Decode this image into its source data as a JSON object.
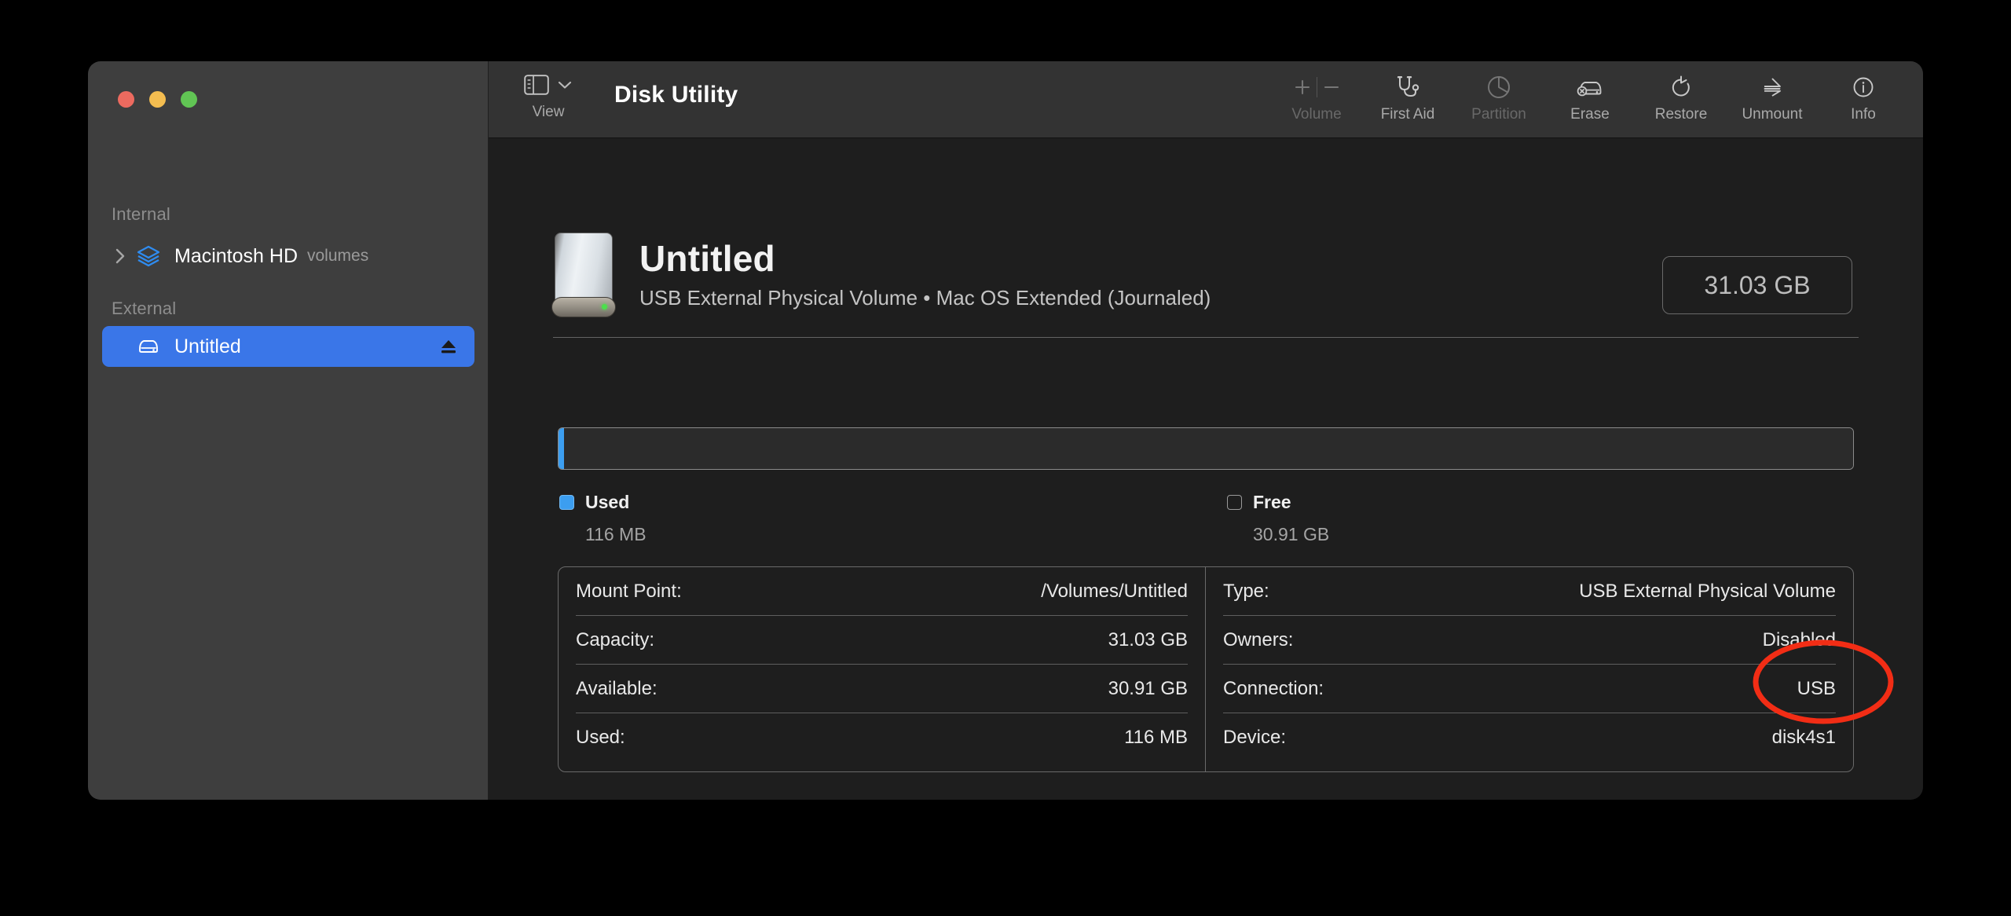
{
  "window": {
    "traffic_lights": [
      "close",
      "minimize",
      "zoom"
    ],
    "colors": {
      "close": "#ec6a5f",
      "minimize": "#f4bd50",
      "zoom": "#61c554",
      "accent": "#3a76e8",
      "used_bar": "#3c9ef0",
      "annotation": "#f22d15"
    }
  },
  "sidebar": {
    "sections": [
      {
        "header": "Internal",
        "items": [
          {
            "label": "Macintosh HD",
            "sub": "volumes",
            "icon": "stacked-layers-icon",
            "disclosure": "chevron-right-icon",
            "selected": false,
            "eject": false
          }
        ]
      },
      {
        "header": "External",
        "items": [
          {
            "label": "Untitled",
            "sub": "",
            "icon": "external-disk-icon",
            "disclosure": "",
            "selected": true,
            "eject": true
          }
        ]
      }
    ]
  },
  "toolbar": {
    "view": {
      "label": "View",
      "icon": "sidebar-toggle-icon",
      "chevron": "chevron-down-icon"
    },
    "app_title": "Disk Utility",
    "items": [
      {
        "label": "Volume",
        "icon": "plus-minus-icon",
        "disabled": true
      },
      {
        "label": "First Aid",
        "icon": "stethoscope-icon",
        "disabled": false
      },
      {
        "label": "Partition",
        "icon": "pie-chart-icon",
        "disabled": true
      },
      {
        "label": "Erase",
        "icon": "disk-erase-icon",
        "disabled": false
      },
      {
        "label": "Restore",
        "icon": "restore-arrow-icon",
        "disabled": false
      },
      {
        "label": "Unmount",
        "icon": "eject-icon",
        "disabled": false
      },
      {
        "label": "Info",
        "icon": "info-circle-icon",
        "disabled": false
      }
    ]
  },
  "volume": {
    "name": "Untitled",
    "subtitle": "USB External Physical Volume • Mac OS Extended (Journaled)",
    "capacity_badge": "31.03 GB",
    "icon": "external-hard-drive-icon"
  },
  "usage": {
    "bar_used_percent": 0.37,
    "legend": [
      {
        "name": "Used",
        "value": "116 MB",
        "swatch": "filled"
      },
      {
        "name": "Free",
        "value": "30.91 GB",
        "swatch": "outline"
      }
    ]
  },
  "info": {
    "left": [
      {
        "key": "Mount Point:",
        "value": "/Volumes/Untitled"
      },
      {
        "key": "Capacity:",
        "value": "31.03 GB"
      },
      {
        "key": "Available:",
        "value": "30.91 GB"
      },
      {
        "key": "Used:",
        "value": "116 MB"
      }
    ],
    "right": [
      {
        "key": "Type:",
        "value": "USB External Physical Volume"
      },
      {
        "key": "Owners:",
        "value": "Disabled"
      },
      {
        "key": "Connection:",
        "value": "USB"
      },
      {
        "key": "Device:",
        "value": "disk4s1"
      }
    ]
  }
}
